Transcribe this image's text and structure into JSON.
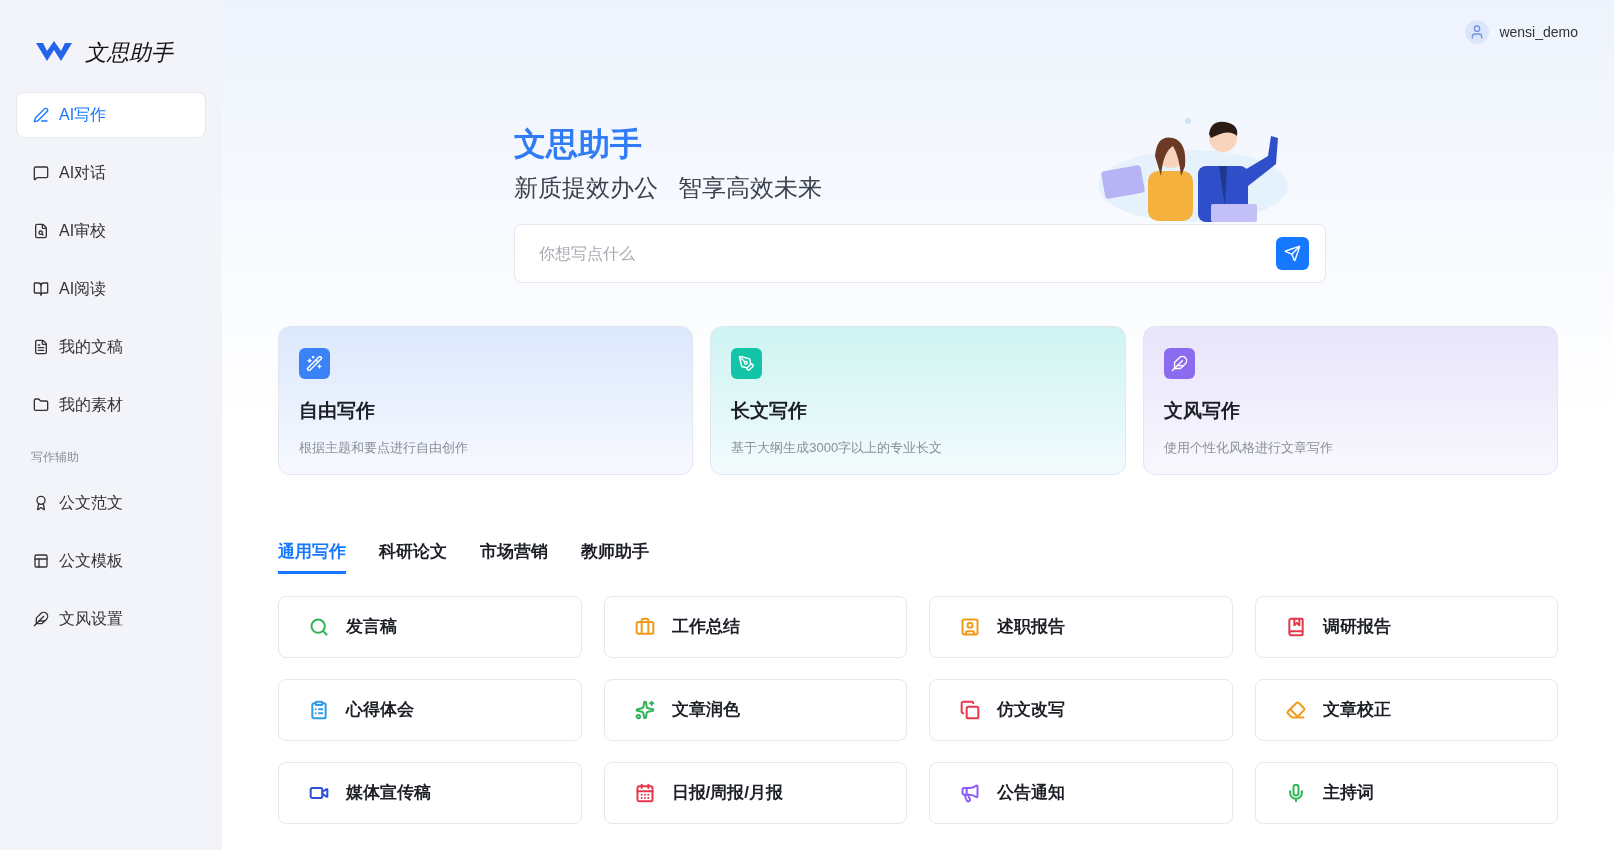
{
  "app": {
    "name": "文思助手"
  },
  "sidebar": {
    "items": [
      {
        "kind": "item",
        "label": "AI写作",
        "selected": true
      },
      {
        "kind": "item",
        "label": "AI对话",
        "selected": false
      },
      {
        "kind": "item",
        "label": "AI审校",
        "selected": false
      },
      {
        "kind": "item",
        "label": "AI阅读",
        "selected": false
      },
      {
        "kind": "item",
        "label": "我的文稿",
        "selected": false
      },
      {
        "kind": "item",
        "label": "我的素材",
        "selected": false
      },
      {
        "kind": "section",
        "label": "写作辅助"
      },
      {
        "kind": "item",
        "label": "公文范文",
        "selected": false
      },
      {
        "kind": "item",
        "label": "公文模板",
        "selected": false
      },
      {
        "kind": "item",
        "label": "文风设置",
        "selected": false
      }
    ]
  },
  "user": {
    "name": "wensi_demo"
  },
  "hero": {
    "title": "文思助手",
    "subtitle": "新质提效办公   智享高效未来"
  },
  "search": {
    "placeholder": "你想写点什么"
  },
  "modes": [
    {
      "title": "自由写作",
      "description": "根据主题和要点进行自由创作",
      "color": "#3b82f6"
    },
    {
      "title": "长文写作",
      "description": "基于大纲生成3000字以上的专业长文",
      "color": "#14c4a8"
    },
    {
      "title": "文风写作",
      "description": "使用个性化风格进行文章写作",
      "color": "#8b6cf0"
    }
  ],
  "tabs": [
    {
      "label": "通用写作",
      "selected": true
    },
    {
      "label": "科研论文",
      "selected": false
    },
    {
      "label": "市场营销",
      "selected": false
    },
    {
      "label": "教师助手",
      "selected": false
    }
  ],
  "templates": [
    {
      "label": "发言稿",
      "color": "#2fb457"
    },
    {
      "label": "工作总结",
      "color": "#f09a1a"
    },
    {
      "label": "述职报告",
      "color": "#f09a1a"
    },
    {
      "label": "调研报告",
      "color": "#e5384b"
    },
    {
      "label": "心得体会",
      "color": "#2c9be8"
    },
    {
      "label": "文章润色",
      "color": "#2fb457"
    },
    {
      "label": "仿文改写",
      "color": "#e5384b"
    },
    {
      "label": "文章校正",
      "color": "#f09a1a"
    },
    {
      "label": "媒体宣传稿",
      "color": "#2b4fd8"
    },
    {
      "label": "日报/周报/月报",
      "color": "#e5384b"
    },
    {
      "label": "公告通知",
      "color": "#8b5cf6"
    },
    {
      "label": "主持词",
      "color": "#2fb457"
    }
  ]
}
